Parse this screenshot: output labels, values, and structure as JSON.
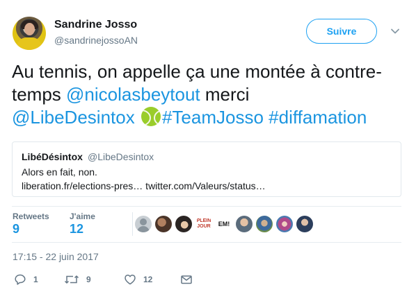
{
  "author": {
    "display_name": "Sandrine Josso",
    "screen_name": "@sandrinejossoAN"
  },
  "follow_button": {
    "label": "Suivre"
  },
  "tweet": {
    "text_part1": "Au tennis, on appelle ça une montée à contre-temps ",
    "mention1": "@nicolasbeytout",
    "text_part2": " merci ",
    "mention2": "@LibeDesintox",
    "emoji": "tennis-ball",
    "hashtag1": "#TeamJosso",
    "hashtag2": "#diffamation"
  },
  "quoted_tweet": {
    "display_name": "LibéDésintox",
    "screen_name": "@LibeDesintox",
    "line1": "Alors en fait, non.",
    "line2": "liberation.fr/elections-pres… twitter.com/Valeurs/status…"
  },
  "stats": {
    "retweets_label": "Retweets",
    "retweets_count": "9",
    "likes_label": "J'aime",
    "likes_count": "12"
  },
  "likers": {
    "liker5_text": "PLEIN JOUR",
    "liker6_text": "EM!"
  },
  "timestamp": "17:15 - 22 juin 2017",
  "actions": {
    "reply_count": "1",
    "retweet_count": "9",
    "like_count": "12"
  },
  "colors": {
    "link": "#1b95e0",
    "follow": "#1da1f2",
    "muted": "#657786"
  }
}
